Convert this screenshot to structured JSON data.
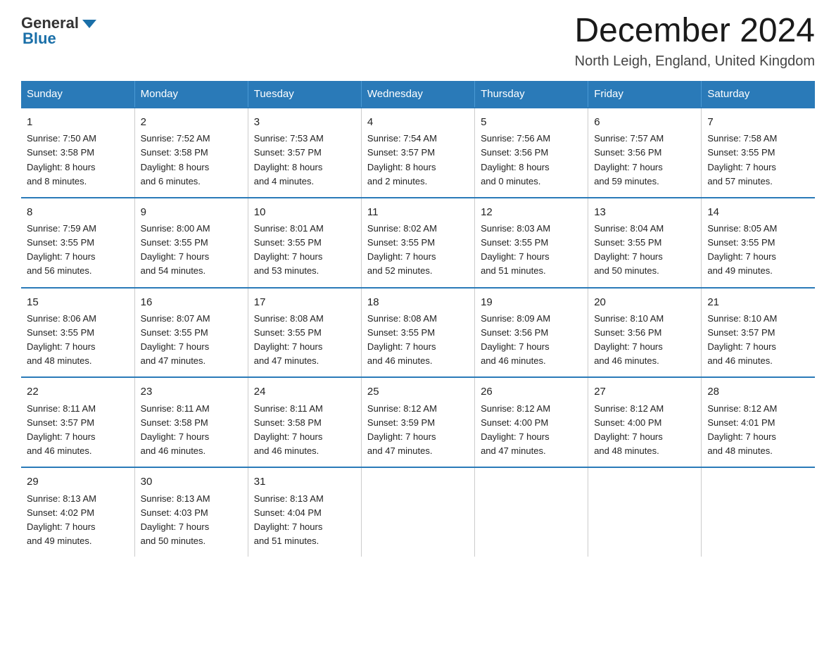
{
  "logo": {
    "general": "General",
    "arrow": "▶",
    "blue": "Blue"
  },
  "header": {
    "month_year": "December 2024",
    "location": "North Leigh, England, United Kingdom"
  },
  "weekdays": [
    "Sunday",
    "Monday",
    "Tuesday",
    "Wednesday",
    "Thursday",
    "Friday",
    "Saturday"
  ],
  "weeks": [
    [
      {
        "day": "1",
        "sunrise": "7:50 AM",
        "sunset": "3:58 PM",
        "daylight": "8 hours and 8 minutes."
      },
      {
        "day": "2",
        "sunrise": "7:52 AM",
        "sunset": "3:58 PM",
        "daylight": "8 hours and 6 minutes."
      },
      {
        "day": "3",
        "sunrise": "7:53 AM",
        "sunset": "3:57 PM",
        "daylight": "8 hours and 4 minutes."
      },
      {
        "day": "4",
        "sunrise": "7:54 AM",
        "sunset": "3:57 PM",
        "daylight": "8 hours and 2 minutes."
      },
      {
        "day": "5",
        "sunrise": "7:56 AM",
        "sunset": "3:56 PM",
        "daylight": "8 hours and 0 minutes."
      },
      {
        "day": "6",
        "sunrise": "7:57 AM",
        "sunset": "3:56 PM",
        "daylight": "7 hours and 59 minutes."
      },
      {
        "day": "7",
        "sunrise": "7:58 AM",
        "sunset": "3:55 PM",
        "daylight": "7 hours and 57 minutes."
      }
    ],
    [
      {
        "day": "8",
        "sunrise": "7:59 AM",
        "sunset": "3:55 PM",
        "daylight": "7 hours and 56 minutes."
      },
      {
        "day": "9",
        "sunrise": "8:00 AM",
        "sunset": "3:55 PM",
        "daylight": "7 hours and 54 minutes."
      },
      {
        "day": "10",
        "sunrise": "8:01 AM",
        "sunset": "3:55 PM",
        "daylight": "7 hours and 53 minutes."
      },
      {
        "day": "11",
        "sunrise": "8:02 AM",
        "sunset": "3:55 PM",
        "daylight": "7 hours and 52 minutes."
      },
      {
        "day": "12",
        "sunrise": "8:03 AM",
        "sunset": "3:55 PM",
        "daylight": "7 hours and 51 minutes."
      },
      {
        "day": "13",
        "sunrise": "8:04 AM",
        "sunset": "3:55 PM",
        "daylight": "7 hours and 50 minutes."
      },
      {
        "day": "14",
        "sunrise": "8:05 AM",
        "sunset": "3:55 PM",
        "daylight": "7 hours and 49 minutes."
      }
    ],
    [
      {
        "day": "15",
        "sunrise": "8:06 AM",
        "sunset": "3:55 PM",
        "daylight": "7 hours and 48 minutes."
      },
      {
        "day": "16",
        "sunrise": "8:07 AM",
        "sunset": "3:55 PM",
        "daylight": "7 hours and 47 minutes."
      },
      {
        "day": "17",
        "sunrise": "8:08 AM",
        "sunset": "3:55 PM",
        "daylight": "7 hours and 47 minutes."
      },
      {
        "day": "18",
        "sunrise": "8:08 AM",
        "sunset": "3:55 PM",
        "daylight": "7 hours and 46 minutes."
      },
      {
        "day": "19",
        "sunrise": "8:09 AM",
        "sunset": "3:56 PM",
        "daylight": "7 hours and 46 minutes."
      },
      {
        "day": "20",
        "sunrise": "8:10 AM",
        "sunset": "3:56 PM",
        "daylight": "7 hours and 46 minutes."
      },
      {
        "day": "21",
        "sunrise": "8:10 AM",
        "sunset": "3:57 PM",
        "daylight": "7 hours and 46 minutes."
      }
    ],
    [
      {
        "day": "22",
        "sunrise": "8:11 AM",
        "sunset": "3:57 PM",
        "daylight": "7 hours and 46 minutes."
      },
      {
        "day": "23",
        "sunrise": "8:11 AM",
        "sunset": "3:58 PM",
        "daylight": "7 hours and 46 minutes."
      },
      {
        "day": "24",
        "sunrise": "8:11 AM",
        "sunset": "3:58 PM",
        "daylight": "7 hours and 46 minutes."
      },
      {
        "day": "25",
        "sunrise": "8:12 AM",
        "sunset": "3:59 PM",
        "daylight": "7 hours and 47 minutes."
      },
      {
        "day": "26",
        "sunrise": "8:12 AM",
        "sunset": "4:00 PM",
        "daylight": "7 hours and 47 minutes."
      },
      {
        "day": "27",
        "sunrise": "8:12 AM",
        "sunset": "4:00 PM",
        "daylight": "7 hours and 48 minutes."
      },
      {
        "day": "28",
        "sunrise": "8:12 AM",
        "sunset": "4:01 PM",
        "daylight": "7 hours and 48 minutes."
      }
    ],
    [
      {
        "day": "29",
        "sunrise": "8:13 AM",
        "sunset": "4:02 PM",
        "daylight": "7 hours and 49 minutes."
      },
      {
        "day": "30",
        "sunrise": "8:13 AM",
        "sunset": "4:03 PM",
        "daylight": "7 hours and 50 minutes."
      },
      {
        "day": "31",
        "sunrise": "8:13 AM",
        "sunset": "4:04 PM",
        "daylight": "7 hours and 51 minutes."
      },
      null,
      null,
      null,
      null
    ]
  ],
  "labels": {
    "sunrise": "Sunrise:",
    "sunset": "Sunset:",
    "daylight": "Daylight:"
  }
}
